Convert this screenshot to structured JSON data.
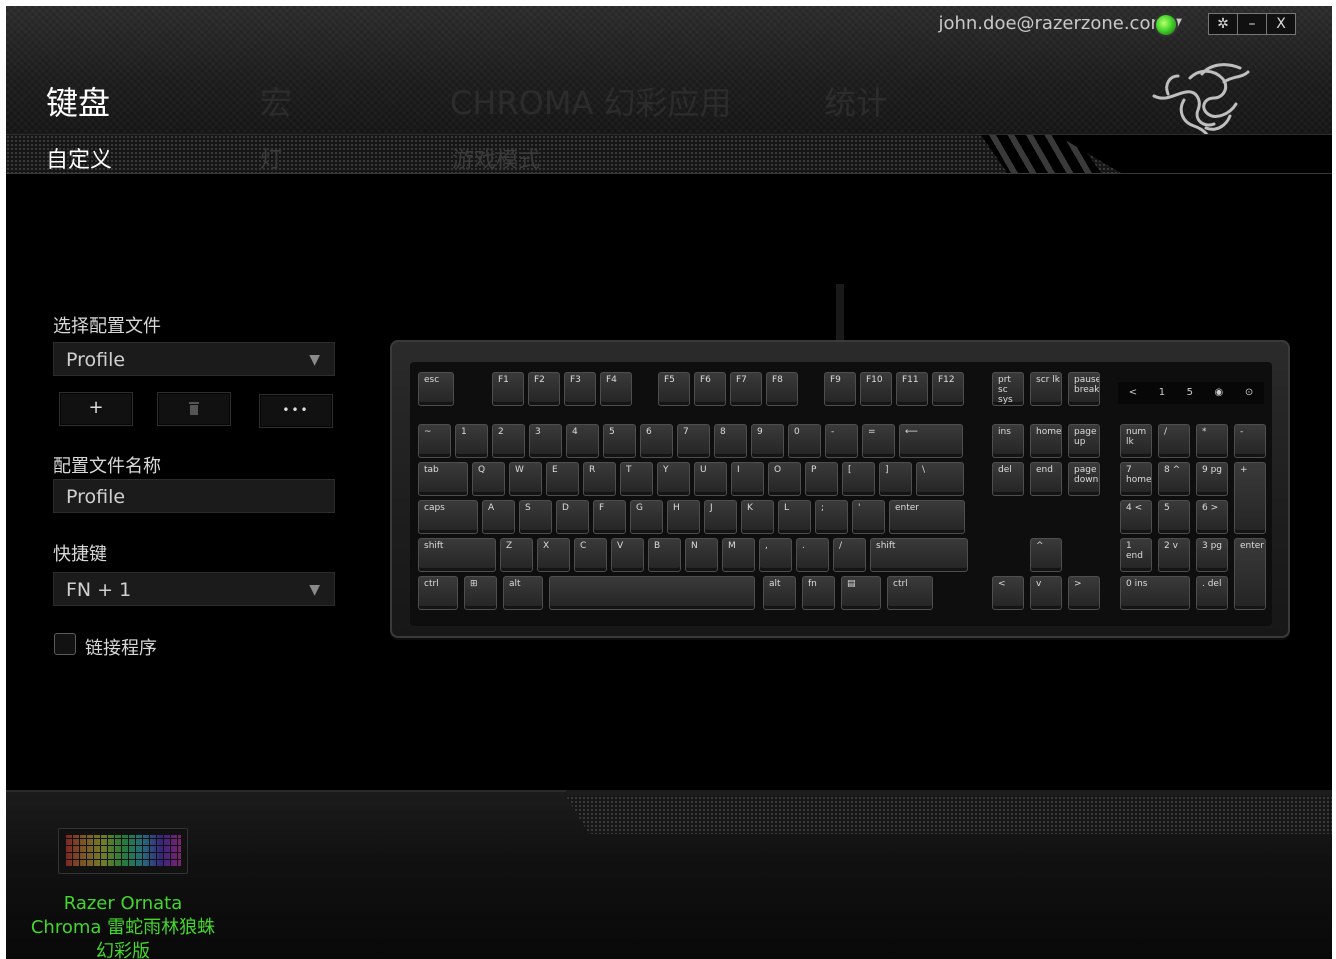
{
  "header": {
    "account_email": "john.doe@razerzone.com",
    "window_buttons": {
      "settings": "✲",
      "minimize": "–",
      "close": "X"
    }
  },
  "nav": {
    "tabs": [
      {
        "label": "键盘",
        "active": true
      },
      {
        "label": "宏",
        "active": false
      },
      {
        "label": "CHROMA 幻彩应用",
        "active": false
      },
      {
        "label": "统计",
        "active": false
      }
    ]
  },
  "subnav": {
    "tabs": [
      {
        "label": "自定义",
        "active": true
      },
      {
        "label": "灯",
        "active": false
      },
      {
        "label": "游戏模式",
        "active": false
      }
    ]
  },
  "profile": {
    "select_label": "选择配置文件",
    "selected": "Profile",
    "add_label": "+",
    "delete_icon": "trash-icon",
    "more_label": "•••",
    "name_label": "配置文件名称",
    "name_value": "Profile",
    "hotkey_label": "快捷键",
    "hotkey_value": "FN + 1",
    "link_program_label": "链接程序",
    "link_program_checked": false
  },
  "keyboard": {
    "row_fn": [
      "esc",
      "F1",
      "F2",
      "F3",
      "F4",
      "F5",
      "F6",
      "F7",
      "F8",
      "F9",
      "F10",
      "F11",
      "F12"
    ],
    "row_fn_right": [
      "prt sc sys rq",
      "scr lk",
      "pause break"
    ],
    "row_num": [
      "~",
      "1",
      "2",
      "3",
      "4",
      "5",
      "6",
      "7",
      "8",
      "9",
      "0",
      "-",
      "=",
      "⟵"
    ],
    "row_q": [
      "tab",
      "Q",
      "W",
      "E",
      "R",
      "T",
      "Y",
      "U",
      "I",
      "O",
      "P",
      "[",
      "]",
      "\\"
    ],
    "row_a": [
      "caps",
      "A",
      "S",
      "D",
      "F",
      "G",
      "H",
      "J",
      "K",
      "L",
      ";",
      "'",
      "enter"
    ],
    "row_z": [
      "shift",
      "Z",
      "X",
      "C",
      "V",
      "B",
      "N",
      "M",
      ",",
      ".",
      "/",
      "shift"
    ],
    "row_ctrl": [
      "ctrl",
      "⊞",
      "alt",
      "",
      "alt",
      "fn",
      "▤",
      "ctrl"
    ],
    "nav_block": [
      "ins",
      "home",
      "page up",
      "del",
      "end",
      "page down"
    ],
    "arrows": [
      "^",
      "<",
      "v",
      ">"
    ],
    "numpad": [
      "num lk",
      "/",
      "*",
      "-",
      "7 home",
      "8 ^",
      "9 pg",
      "+",
      "4 <",
      "5",
      "6 >",
      "1 end",
      "2 v",
      "3 pg",
      "enter",
      "0 ins",
      ". del"
    ],
    "strip_labels": [
      "<",
      "1",
      "5",
      "◉",
      "⊙"
    ]
  },
  "device": {
    "name": "Razer Ornata Chroma 雷蛇雨林狼蛛幻彩版"
  },
  "colors": {
    "accent": "#44d62c",
    "background": "#000000",
    "panel": "#1b1b1b"
  }
}
